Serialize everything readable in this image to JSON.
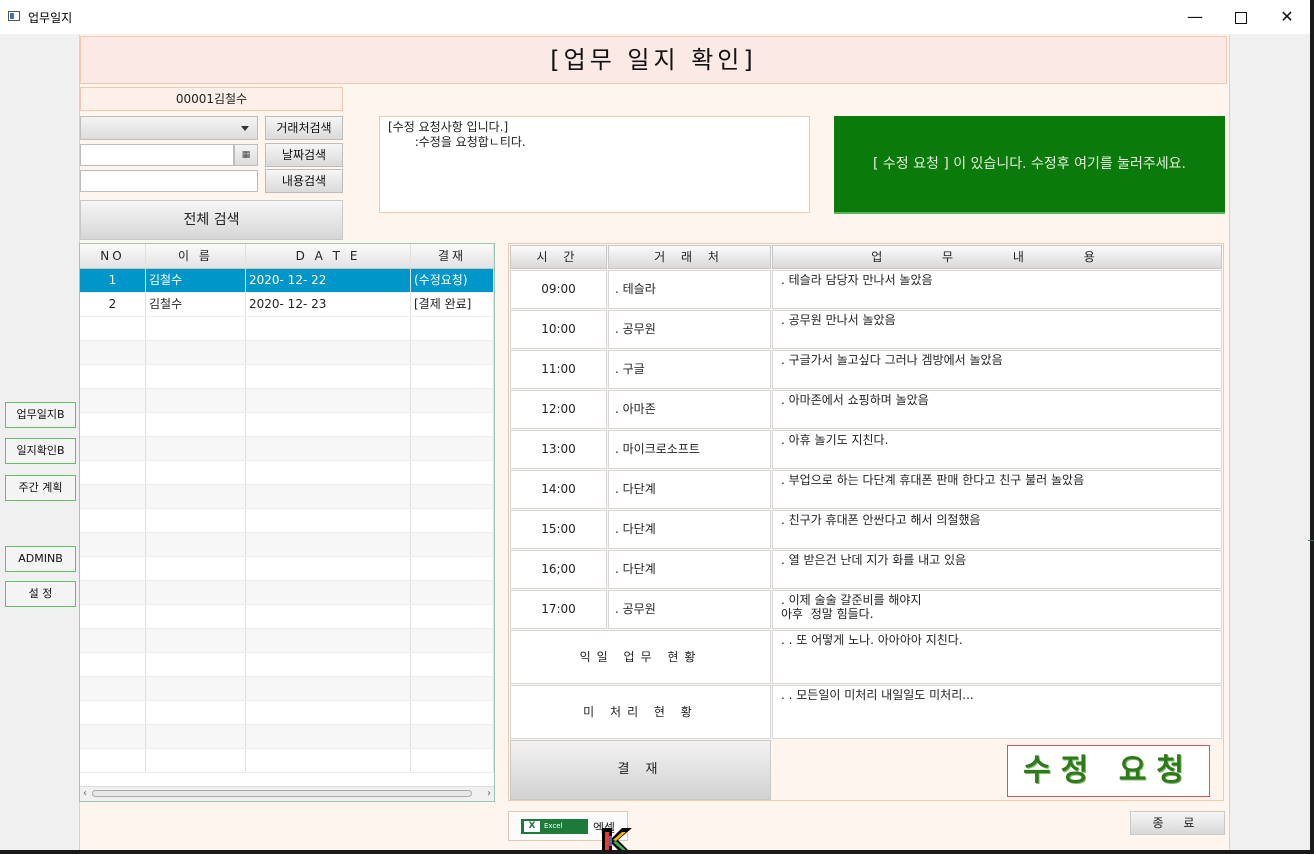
{
  "window": {
    "title": "업무일지",
    "min_symbol": "—",
    "close_symbol": "✕"
  },
  "header": {
    "title": "[업무  일지  확인]"
  },
  "search": {
    "user": "00001김철수",
    "client_search_label": "거래처검색",
    "date_search_label": "날짜검색",
    "content_search_label": "내용검색",
    "full_search_label": "전체 검색",
    "calendar_icon": "▦"
  },
  "memo": {
    "text": "[수정 요청사항 입니다.]\n       :수정을 요청합ㄴ티다."
  },
  "notice": {
    "text": "[ 수정 요청 ] 이 있습니다. 수정후 여기를 눌러주세요.",
    "color": "#0a7a0a"
  },
  "left_table": {
    "headers": [
      "NO",
      "이 름",
      "D A T E",
      "결재"
    ],
    "rows": [
      {
        "no": "1",
        "name": "김철수",
        "date": "2020- 12- 22",
        "status": "(수정요청)"
      },
      {
        "no": "2",
        "name": "김철수",
        "date": "2020- 12- 23",
        "status": "[결제 완료]"
      }
    ],
    "selected_color": "#0096c9"
  },
  "log": {
    "headers": {
      "time": "시 간",
      "client": "거 래 처",
      "content": "업 무 내 용"
    },
    "rows": [
      {
        "time": "09:00",
        "client": ". 테슬라",
        "content": ". 테슬라 담당자 만나서 놀았음"
      },
      {
        "time": "10:00",
        "client": ". 공무원",
        "content": ". 공무원 만나서 놀았음"
      },
      {
        "time": "11:00",
        "client": ". 구글",
        "content": ". 구글가서 놀고싶다 그러나 겜방에서 놀았음"
      },
      {
        "time": "12:00",
        "client": ". 아마존",
        "content": ". 아마존에서 쇼핑하며 놀았음"
      },
      {
        "time": "13:00",
        "client": ". 마이크로소프트",
        "content": ". 아휴 놀기도 지친다."
      },
      {
        "time": "14:00",
        "client": ". 다단계",
        "content": ". 부업으로 하는 다단계 휴대폰 판매 한다고 친구 불러 놀았음"
      },
      {
        "time": "15:00",
        "client": ". 다단계",
        "content": ". 친구가 휴대폰 안싼다고 해서 의절했음"
      },
      {
        "time": "16;00",
        "client": ". 다단계",
        "content": ". 열 받은건 난데 지가 화를 내고 있음"
      },
      {
        "time": "17:00",
        "client": ". 공무원",
        "content": ". 이제 술술 갈준비를 해야지\n아후  정말 힘들다."
      }
    ],
    "next_day_label": "익일 업무 현황",
    "next_day_text": ". . 또 어떻게 노나. 아아아아 지친다.",
    "pending_label": "미 처리   현 황",
    "pending_text": ". . 모든일이 미처리 내일일도 미처리..."
  },
  "actions": {
    "approve_label": "결 재",
    "revise_label": "수정 요청",
    "revise_color": "#2e7a1a",
    "excel_label": "엑셀",
    "excel_logo_text": "Excel",
    "excel_logo_mark": "X",
    "close_label": "종 료"
  },
  "sidebar": {
    "items": [
      "업무일지B",
      "일지확인B",
      "주간 계획",
      "ADMINB",
      "설 정"
    ]
  }
}
